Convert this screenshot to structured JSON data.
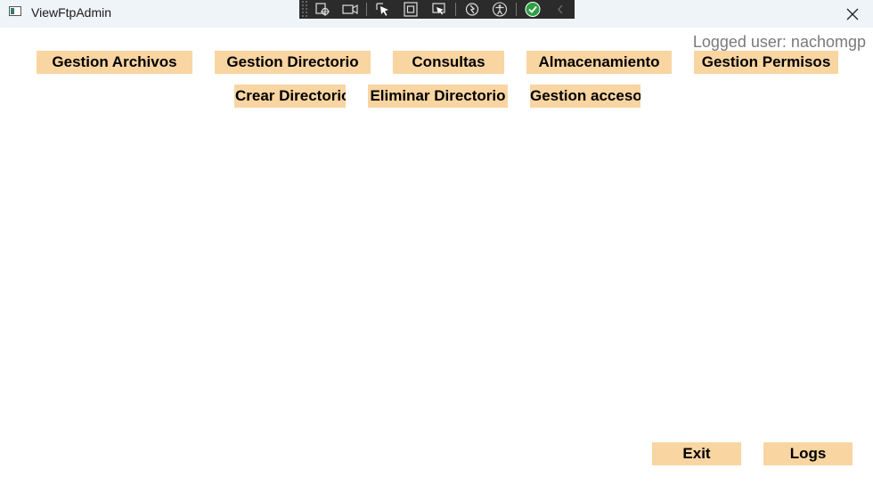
{
  "window": {
    "title": "ViewFtpAdmin"
  },
  "devtools": {
    "tools": [
      "live-visual-tree-icon",
      "video-icon",
      "select-element-icon",
      "layout-adorner-icon",
      "track-focus-icon",
      "hot-reload-icon",
      "accessibility-icon",
      "check-icon",
      "collapse-chevron-icon"
    ]
  },
  "header": {
    "logged_user": "Logged user: nachomgp"
  },
  "menu": {
    "row1": [
      "Gestion Archivos",
      "Gestion Directorio",
      "Consultas",
      "Almacenamiento",
      "Gestion Permisos"
    ],
    "row2": [
      "Crear Directorio",
      "Eliminar Directorio",
      "Gestion acceso"
    ]
  },
  "footer": {
    "exit_label": "Exit",
    "logs_label": "Logs"
  },
  "colors": {
    "button_bg": "#f9d5a2",
    "titlebar_bg": "#eff4f9",
    "logged_user_text": "#7a7a7a",
    "devbar_bg": "#2b2b2b",
    "check_green": "#2ea043"
  }
}
